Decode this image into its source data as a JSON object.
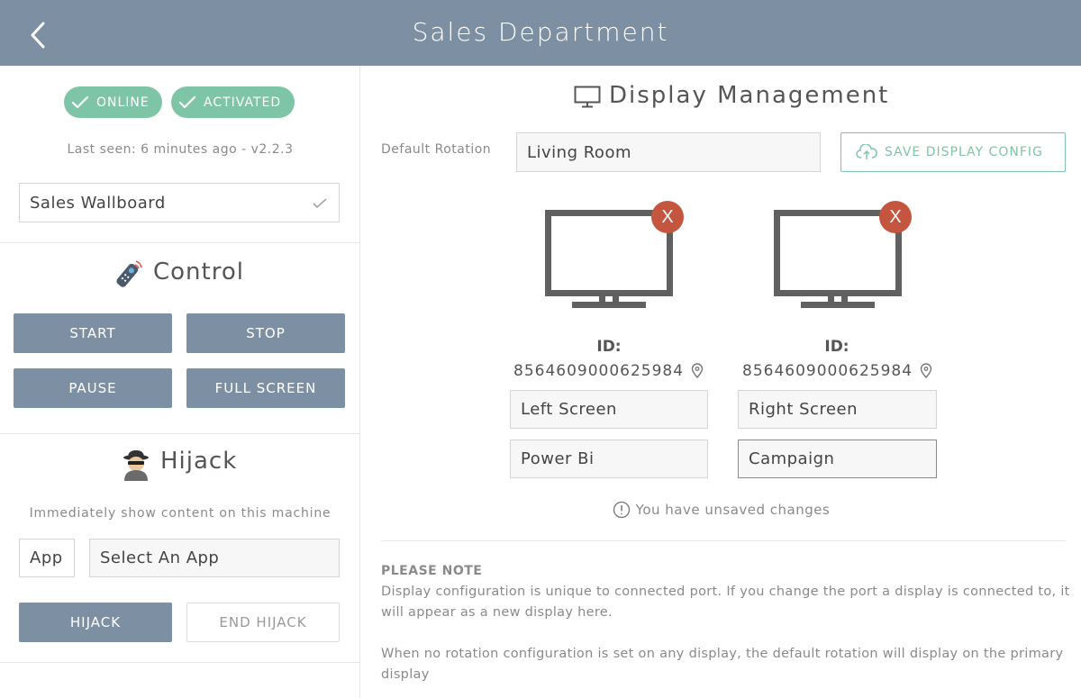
{
  "header": {
    "title": "Sales Department"
  },
  "status": {
    "online_label": "ONLINE",
    "activated_label": "ACTIVATED",
    "last_seen": "Last seen: 6 minutes ago - v2.2.3"
  },
  "wallboard": {
    "value": "Sales Wallboard"
  },
  "control": {
    "title": "Control",
    "start_label": "START",
    "stop_label": "STOP",
    "pause_label": "PAUSE",
    "fullscreen_label": "FULL SCREEN"
  },
  "hijack": {
    "title": "Hijack",
    "description": "Immediately show content on this machine",
    "type_value": "App",
    "app_value": "Select An App",
    "hijack_label": "HIJACK",
    "end_label": "END HIJACK"
  },
  "display_management": {
    "title": "Display Management",
    "default_rotation_label": "Default Rotation",
    "default_rotation_value": "Living Room",
    "save_label": "SAVE DISPLAY CONFIG",
    "displays": [
      {
        "id_label": "ID:",
        "id_value": "8564609000625984",
        "name": "Left Screen",
        "content": "Power Bi",
        "remove_label": "X"
      },
      {
        "id_label": "ID:",
        "id_value": "8564609000625984",
        "name": "Right Screen",
        "content": "Campaign",
        "remove_label": "X"
      }
    ],
    "unsaved_message": "You have unsaved changes"
  },
  "note": {
    "title": "PLEASE NOTE",
    "paragraph1": "Display configuration is unique to connected port. If you change the port a display is connected to, it will appear as a new display here.",
    "paragraph2": "When no rotation configuration is set on any display, the default rotation will display on the primary display"
  },
  "colors": {
    "header": "#7d8fa2",
    "accent_green": "#7dc5a6",
    "danger": "#c4553e",
    "button": "#7d8fa2"
  }
}
